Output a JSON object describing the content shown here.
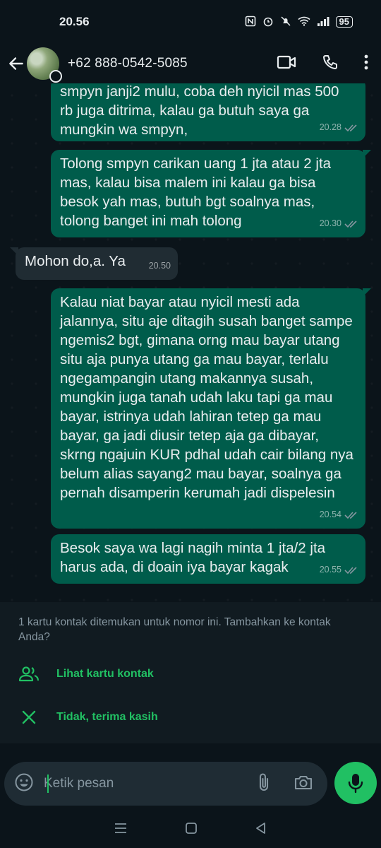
{
  "status_bar": {
    "time": "20.56",
    "battery": "95"
  },
  "header": {
    "contact_name": "+62 888-0542-5085"
  },
  "messages": [
    {
      "direction": "out",
      "text": "smpyn janji2 mulu, coba deh nyicil mas 500 rb juga ditrima, kalau ga butuh saya ga mungkin wa smpyn,",
      "time": "20.28"
    },
    {
      "direction": "out",
      "text": "Tolong smpyn carikan uang 1 jta atau 2 jta mas, kalau bisa malem ini kalau ga bisa besok yah mas, butuh bgt soalnya mas, tolong banget ini mah tolong",
      "time": "20.30"
    },
    {
      "direction": "in",
      "text": "Mohon do,a. Ya",
      "time": "20.50"
    },
    {
      "direction": "out",
      "text": "Kalau niat bayar atau nyicil mesti ada jalannya, situ aje ditagih susah banget sampe ngemis2 bgt, gimana orng mau bayar utang situ aja punya utang ga mau bayar, terlalu ngegampangin utang makannya susah, mungkin juga tanah udah laku tapi ga mau bayar, istrinya udah lahiran tetep ga mau bayar, ga jadi diusir tetep aja ga dibayar, skrng ngajuin KUR pdhal udah cair bilang nya belum alias sayang2 mau bayar, soalnya ga pernah disamperin kerumah jadi dispelesin",
      "time": "20.54"
    },
    {
      "direction": "out",
      "text": "Besok saya wa lagi nagih minta 1 jta/2 jta harus ada, di doain iya bayar kagak",
      "time": "20.55"
    }
  ],
  "contact_card": {
    "notice": "1 kartu kontak ditemukan untuk nomor ini. Tambahkan ke kontak Anda?",
    "view_label": "Lihat kartu kontak",
    "decline_label": "Tidak, terima kasih"
  },
  "composer": {
    "placeholder": "Ketik pesan"
  },
  "colors": {
    "outgoing": "#005c4b",
    "incoming": "#202c33",
    "accent": "#21c063",
    "background": "#0b141a"
  }
}
